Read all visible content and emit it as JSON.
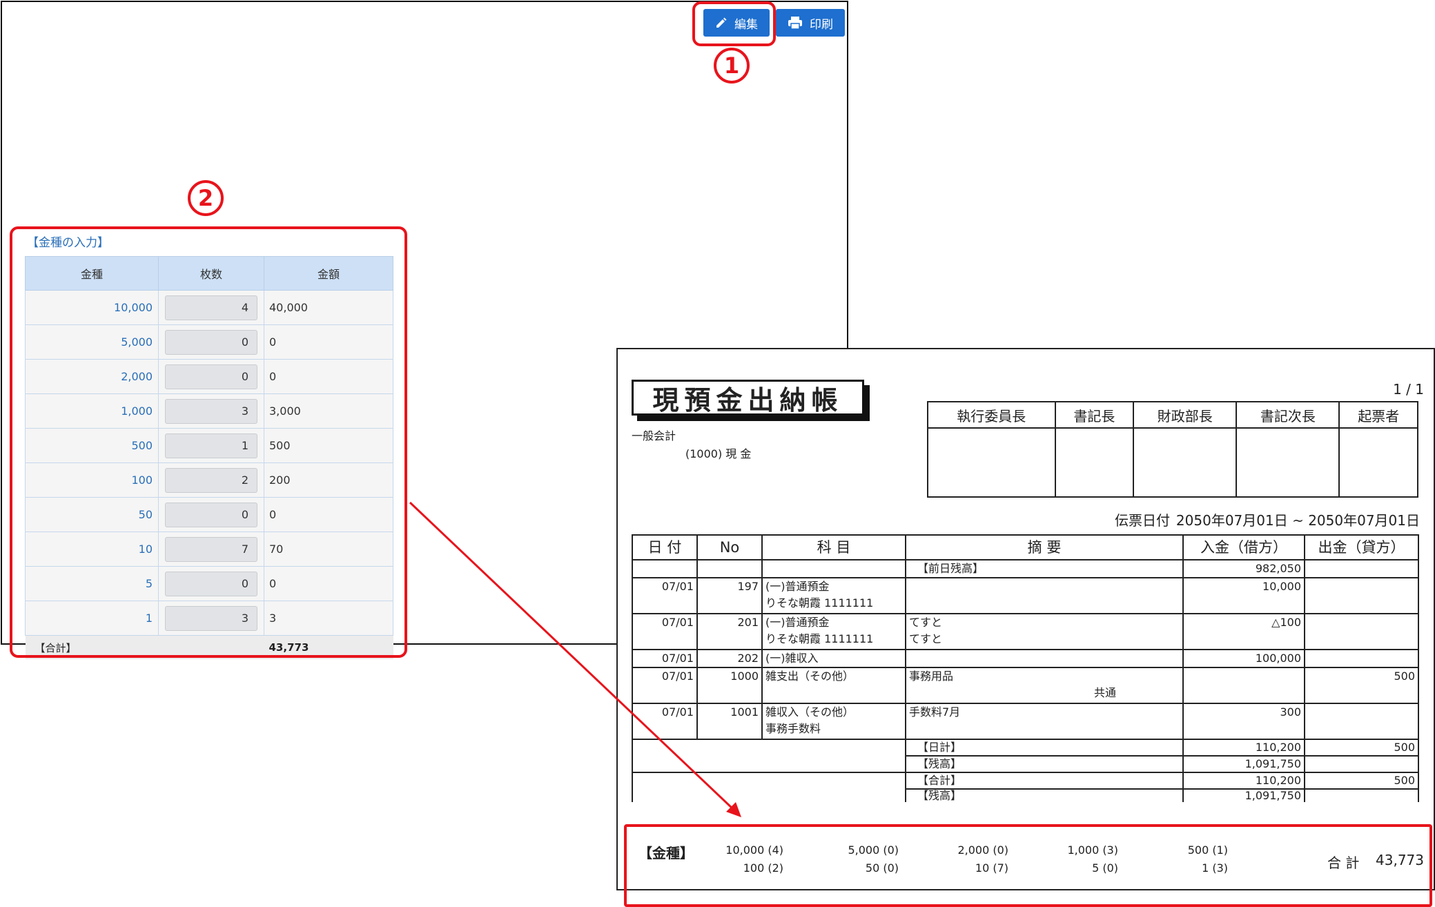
{
  "toolbar": {
    "edit_label": "編集",
    "print_label": "印刷"
  },
  "callouts": {
    "one": "1",
    "two": "2"
  },
  "denomination_panel": {
    "title": "【金種の入力】",
    "headers": [
      "金種",
      "枚数",
      "金額"
    ],
    "rows": [
      {
        "denom": "10,000",
        "qty": "4",
        "amount": "40,000"
      },
      {
        "denom": "5,000",
        "qty": "0",
        "amount": "0"
      },
      {
        "denom": "2,000",
        "qty": "0",
        "amount": "0"
      },
      {
        "denom": "1,000",
        "qty": "3",
        "amount": "3,000"
      },
      {
        "denom": "500",
        "qty": "1",
        "amount": "500"
      },
      {
        "denom": "100",
        "qty": "2",
        "amount": "200"
      },
      {
        "denom": "50",
        "qty": "0",
        "amount": "0"
      },
      {
        "denom": "10",
        "qty": "7",
        "amount": "70"
      },
      {
        "denom": "5",
        "qty": "0",
        "amount": "0"
      },
      {
        "denom": "1",
        "qty": "3",
        "amount": "3"
      }
    ],
    "total_label": "【合計】",
    "total_value": "43,773"
  },
  "report": {
    "page": "1 / 1",
    "title": "現預金出納帳",
    "account_group": "一般会計",
    "account": "(1000) 現 金",
    "approvals": [
      "執行委員長",
      "書記長",
      "財政部長",
      "書記次長",
      "起票者"
    ],
    "date_label": "伝票日付",
    "date_range": "2050年07月01日 ~ 2050年07月01日",
    "headers": [
      "日 付",
      "No",
      "科 目",
      "摘 要",
      "入金（借方）",
      "出金（貸方）"
    ],
    "prev_balance_label": "【前日残高】",
    "prev_balance": "982,050",
    "entries": [
      {
        "date": "07/01",
        "no": "197",
        "subject1": "(一)普通預金",
        "subject2": "りそな朝霞 1111111",
        "memo1": "",
        "memo2": "",
        "debit": "10,000",
        "credit": ""
      },
      {
        "date": "07/01",
        "no": "201",
        "subject1": "(一)普通預金",
        "subject2": "りそな朝霞 1111111",
        "memo1": "てすと",
        "memo2": "てすと",
        "debit": "△100",
        "credit": ""
      },
      {
        "date": "07/01",
        "no": "202",
        "subject1": "(一)雑収入",
        "subject2": "",
        "memo1": "",
        "memo2": "",
        "debit": "100,000",
        "credit": ""
      },
      {
        "date": "07/01",
        "no": "1000",
        "subject1": "雑支出（その他）",
        "subject2": "",
        "memo1": "事務用品",
        "memo2": "共通",
        "debit": "",
        "credit": "500"
      },
      {
        "date": "07/01",
        "no": "1001",
        "subject1": "雑収入（その他）",
        "subject2": "事務手数料",
        "memo1": "手数料7月",
        "memo2": "",
        "debit": "300",
        "credit": ""
      }
    ],
    "daily_total_label": "【日計】",
    "daily_total_debit": "110,200",
    "daily_total_credit": "500",
    "daily_balance_label": "【残高】",
    "daily_balance": "1,091,750",
    "grand_total_label": "【合計】",
    "grand_total_debit": "110,200",
    "grand_total_credit": "500",
    "grand_balance_label": "【残高】",
    "grand_balance": "1,091,750",
    "denomination_footer": {
      "label": "【金種】",
      "row1": [
        "10,000 (4)",
        "5,000 (0)",
        "2,000 (0)",
        "1,000 (3)",
        "500 (1)"
      ],
      "row2": [
        "100 (2)",
        "50 (0)",
        "10 (7)",
        "5 (0)",
        "1 (3)"
      ],
      "total_label": "合 計",
      "total_value": "43,773"
    }
  },
  "colors": {
    "button_blue": "#1e6fcf",
    "callout_red": "#e8141c",
    "header_blue": "#cde0f6",
    "link_blue": "#2a6fb8"
  }
}
